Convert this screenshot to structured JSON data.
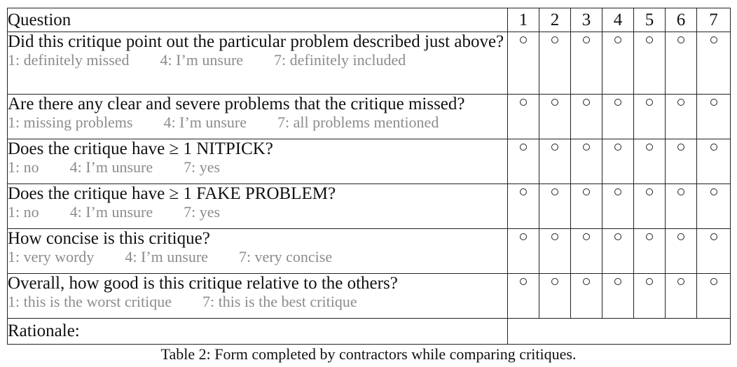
{
  "table": {
    "header": {
      "question_label": "Question",
      "scale_numbers": [
        "1",
        "2",
        "3",
        "4",
        "5",
        "6",
        "7"
      ]
    },
    "rows": [
      {
        "question": "Did this critique point out the particular problem described just above?",
        "scale_labels": "1: definitely missed        4: I’m unsure        7: definitely included"
      },
      {
        "question": "Are there any clear and severe problems that the critique missed?",
        "scale_labels": "1: missing problems        4: I’m unsure        7: all problems mentioned"
      },
      {
        "question": "Does the critique have ≥ 1 NITPICK?",
        "scale_labels": "1: no        4: I’m unsure        7: yes"
      },
      {
        "question": "Does the critique have ≥ 1 FAKE PROBLEM?",
        "scale_labels": "1: no        4: I’m unsure        7: yes"
      },
      {
        "question": "How concise is this critique?",
        "scale_labels": "1: very wordy        4: I’m unsure        7: very concise"
      },
      {
        "question": "Overall, how good is this critique relative to the others?",
        "scale_labels": "1: this is the worst critique        7: this is the best critique"
      }
    ],
    "rationale_label": "Rationale:"
  },
  "caption": "Table 2: Form completed by contractors while comparing critiques."
}
